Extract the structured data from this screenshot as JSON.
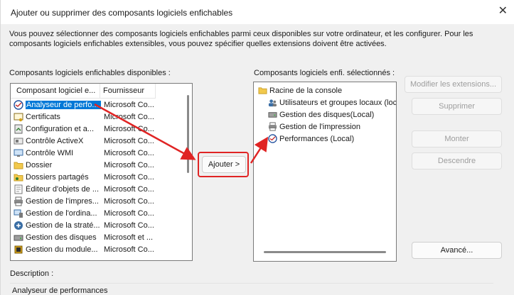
{
  "window": {
    "title": "Ajouter ou supprimer des composants logiciels enfichables",
    "close_glyph": "✕"
  },
  "intro_text": "Vous pouvez sélectionner des composants logiciels enfichables parmi ceux disponibles sur votre ordinateur, et les configurer. Pour les composants logiciels enfichables extensibles, vous pouvez spécifier quelles extensions doivent être activées.",
  "available": {
    "label": "Composants logiciels enfichables disponibles :",
    "columns": [
      "Composant logiciel e...",
      "Fournisseur"
    ],
    "items": [
      {
        "name": "Analyseur de perfo...",
        "provider": "Microsoft Co...",
        "icon": "performance-icon",
        "selected": true
      },
      {
        "name": "Certificats",
        "provider": "Microsoft Co...",
        "icon": "certificate-icon"
      },
      {
        "name": "Configuration et a...",
        "provider": "Microsoft Co...",
        "icon": "configuration-icon"
      },
      {
        "name": "Contrôle ActiveX",
        "provider": "Microsoft Co...",
        "icon": "activex-icon"
      },
      {
        "name": "Contrôle WMI",
        "provider": "Microsoft Co...",
        "icon": "wmi-icon"
      },
      {
        "name": "Dossier",
        "provider": "Microsoft Co...",
        "icon": "folder-icon"
      },
      {
        "name": "Dossiers partagés",
        "provider": "Microsoft Co...",
        "icon": "shared-folders-icon"
      },
      {
        "name": "Éditeur d'objets de ...",
        "provider": "Microsoft Co...",
        "icon": "policy-editor-icon"
      },
      {
        "name": "Gestion de l'impres...",
        "provider": "Microsoft Co...",
        "icon": "printer-icon"
      },
      {
        "name": "Gestion de l'ordina...",
        "provider": "Microsoft Co...",
        "icon": "computer-management-icon"
      },
      {
        "name": "Gestion de la straté...",
        "provider": "Microsoft Co...",
        "icon": "policy-management-icon"
      },
      {
        "name": "Gestion des disques",
        "provider": "Microsoft et ...",
        "icon": "disk-icon"
      },
      {
        "name": "Gestion du module...",
        "provider": "Microsoft Co...",
        "icon": "tpm-icon"
      }
    ]
  },
  "selected": {
    "label": "Composants logiciels enfi. sélectionnés :",
    "root": {
      "name": "Racine de la console",
      "icon": "folder-icon"
    },
    "children": [
      {
        "name": "Utilisateurs et groupes locaux (loca",
        "icon": "users-icon"
      },
      {
        "name": "Gestion des disques(Local)",
        "icon": "disk-icon"
      },
      {
        "name": "Gestion de l'impression",
        "icon": "printer-icon"
      },
      {
        "name": "Performances (Local)",
        "icon": "performance-icon"
      }
    ]
  },
  "buttons": {
    "add": "Ajouter >",
    "edit_extensions": "Modifier les extensions...",
    "remove": "Supprimer",
    "move_up": "Monter",
    "move_down": "Descendre",
    "advanced": "Avancé..."
  },
  "description": {
    "label": "Description :",
    "text": "Analyseur de performances"
  },
  "colors": {
    "annotation": "#e02424",
    "selection": "#0078d7"
  }
}
